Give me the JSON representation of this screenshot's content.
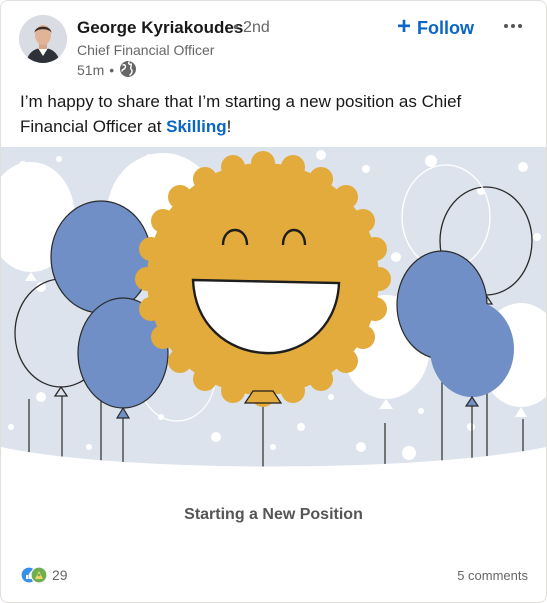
{
  "author": {
    "name": "George Kyriakoudes",
    "connection_degree": "• 2nd",
    "headline": "Chief Financial Officer",
    "time_posted": "51m",
    "visibility_icon": "globe-icon"
  },
  "actions": {
    "follow_label": "Follow",
    "follow_icon": "plus-icon",
    "more_icon": "ellipsis-icon"
  },
  "post": {
    "text_prefix": "I’m happy to share that I’m starting a new position as Chief Financial Officer at ",
    "company": "Skilling",
    "text_suffix": "!"
  },
  "media": {
    "caption": "Starting a New Position",
    "illustration": "smiling-sun-balloons-illustration"
  },
  "social": {
    "reaction_icons": [
      "like-reaction-icon",
      "celebrate-reaction-icon"
    ],
    "reaction_count": "29",
    "comments": "5 comments"
  },
  "colors": {
    "accent": "#0a66c2",
    "balloon_blue": "#6f8fc6",
    "sun_gold": "#e2ab3b",
    "media_bg": "#dde3ec"
  }
}
